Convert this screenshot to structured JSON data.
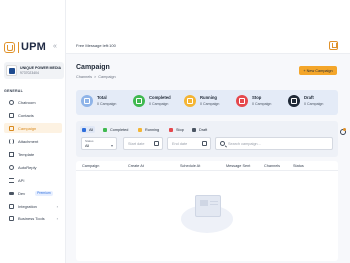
{
  "brand": {
    "logo_text": "UPM"
  },
  "org": {
    "name": "UNIQUE POWER MEDIA",
    "phone": "9737023404"
  },
  "sidebar": {
    "section_label": "GENERAL",
    "items": [
      {
        "label": "Chatroom"
      },
      {
        "label": "Contacts"
      },
      {
        "label": "Campaign"
      },
      {
        "label": "Attachment"
      },
      {
        "label": "Template"
      },
      {
        "label": "AutoReply"
      },
      {
        "label": "API"
      },
      {
        "label": "Dev",
        "badge": "Premium"
      },
      {
        "label": "Integration"
      },
      {
        "label": "Business Tools"
      }
    ]
  },
  "topbar": {
    "free_message": "Free Message left:100"
  },
  "page": {
    "title": "Campaign",
    "breadcrumb": [
      "Channels",
      "Campaign"
    ],
    "breadcrumb_sep": ">",
    "new_button": "+ New Campaign"
  },
  "stats": [
    {
      "label": "Total",
      "value": "0 Campaign",
      "color": "#8fb4e8"
    },
    {
      "label": "Completed",
      "value": "0 Campaign",
      "color": "#3fb950"
    },
    {
      "label": "Running",
      "value": "0 Campaign",
      "color": "#f4b534"
    },
    {
      "label": "Stop",
      "value": "0 Campaign",
      "color": "#e5484d"
    },
    {
      "label": "Draft",
      "value": "0 Campaign",
      "color": "#1f2937"
    }
  ],
  "filters": {
    "chips": [
      {
        "label": "All",
        "color": "#2f6fdc"
      },
      {
        "label": "Completed",
        "color": "#3fb950"
      },
      {
        "label": "Running",
        "color": "#f4b534"
      },
      {
        "label": "Stop",
        "color": "#e5484d"
      },
      {
        "label": "Draft",
        "color": "#4b5563"
      }
    ],
    "status_caption": "Status",
    "status_value": "All",
    "start_date_placeholder": "Start date",
    "end_date_placeholder": "End date",
    "search_placeholder": "Search campaign..."
  },
  "table": {
    "columns": [
      "Campaign",
      "Create At",
      "Schedule At",
      "Message Sent",
      "Channels",
      "Status"
    ]
  }
}
